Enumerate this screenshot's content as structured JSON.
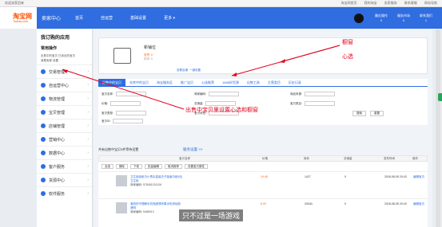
{
  "topbar": {
    "left": "欢迎卖家回来",
    "user": "您好:菜萌...",
    "links": [
      "淘宝网首页",
      "我的淘宝",
      "卖家服务",
      "联系客服",
      "网站导航"
    ]
  },
  "nav": {
    "logo": "淘宝网",
    "logo_sub": "Taobao.com",
    "brand": "卖家中心",
    "items": [
      "首页",
      "自运营",
      "基础设置",
      "更多 ▾"
    ],
    "stats": [
      {
        "n": "0",
        "l": "最近操作"
      },
      {
        "n": "0",
        "l": "服务市场"
      },
      {
        "n": "1",
        "l": "联系我们"
      }
    ]
  },
  "sidebar": {
    "title": "我订购的应用",
    "subtitle": "常用操作",
    "quick": [
      "出售中的宝贝",
      "已卖出的宝贝",
      "我是卖家",
      "设置"
    ],
    "items": [
      "交易管理",
      "自运营中心",
      "物流管理",
      "宝贝管理",
      "店铺管理",
      "营销中心",
      "数据中心",
      "客户服务",
      "货源中心",
      "软件服务"
    ]
  },
  "shop": {
    "name": "新铺位",
    "line1": "信誉: 0",
    "line2": "好评: 0",
    "link1": "查看店铺",
    "link2": "一键设置"
  },
  "tabs": [
    "出售中的宝贝",
    "仓库中的宝贝",
    "淘宝服务区",
    "推广宝贝",
    "心选推荐",
    "1688好货源",
    "出售工具",
    "主营类目",
    "历史记录"
  ],
  "form": {
    "labels": [
      "宝贝名称:",
      "价格:",
      "宝贝类型:",
      "宝贝状态:",
      "商家编码:",
      "总销量:",
      "商品来源:",
      "宝贝类目:",
      "宝贝ID:"
    ],
    "search": "搜索",
    "reset": "重置"
  },
  "pending": "共有出售中宝贝3件等待设置",
  "manage": "服务设置 >>",
  "table": {
    "headers": [
      "",
      "宝贝名称",
      "",
      "价格",
      "库存",
      "总销量",
      "发布时间",
      "操作"
    ],
    "tools": [
      "全选",
      "删除",
      "下架",
      "批量编辑",
      "取消推荐",
      "设置宝贝属性"
    ],
    "rows": [
      {
        "title": "卫生用纸纸巾小青杂盒装夫子装面巾纸5包卫生纸",
        "code": "商家编码: 578481201126",
        "price": "19.48",
        "qty": "1427",
        "sold": "0",
        "date": "2018-08-05 20:43",
        "edit": "编辑宝贝"
      },
      {
        "title": "潮流的不理解手机壳超薄苹果手机壳硅胶透明",
        "code": "商家编码: 5468013",
        "price": "8.99",
        "qty": "20044",
        "sold": "0",
        "date": "2018-08-05 20:43",
        "edit": "编辑宝贝"
      }
    ]
  },
  "annotations": {
    "a1": "橱窗",
    "a2": "心选",
    "a3": "出售中宝贝里设置心选和橱窗",
    "sub": "只不过是一场游戏"
  }
}
